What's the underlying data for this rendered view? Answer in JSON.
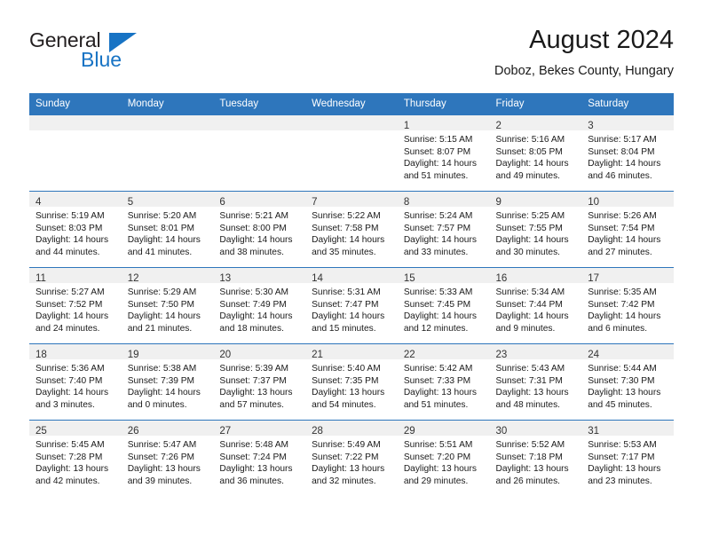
{
  "brand": {
    "name_part1": "General",
    "name_part2": "Blue",
    "accent_color": "#1773c4"
  },
  "header": {
    "title": "August 2024",
    "subtitle": "Doboz, Bekes County, Hungary"
  },
  "theme": {
    "header_bg": "#2e76bc",
    "daynum_band_bg": "#f0f0f0",
    "cell_bg": "#ffffff",
    "text_color": "#1a1a1a"
  },
  "weekdays": [
    "Sunday",
    "Monday",
    "Tuesday",
    "Wednesday",
    "Thursday",
    "Friday",
    "Saturday"
  ],
  "weeks": [
    [
      {
        "day": "",
        "sunrise": "",
        "sunset": "",
        "daylight1": "",
        "daylight2": "",
        "empty": true
      },
      {
        "day": "",
        "sunrise": "",
        "sunset": "",
        "daylight1": "",
        "daylight2": "",
        "empty": true
      },
      {
        "day": "",
        "sunrise": "",
        "sunset": "",
        "daylight1": "",
        "daylight2": "",
        "empty": true
      },
      {
        "day": "",
        "sunrise": "",
        "sunset": "",
        "daylight1": "",
        "daylight2": "",
        "empty": true
      },
      {
        "day": "1",
        "sunrise": "Sunrise: 5:15 AM",
        "sunset": "Sunset: 8:07 PM",
        "daylight1": "Daylight: 14 hours",
        "daylight2": "and 51 minutes."
      },
      {
        "day": "2",
        "sunrise": "Sunrise: 5:16 AM",
        "sunset": "Sunset: 8:05 PM",
        "daylight1": "Daylight: 14 hours",
        "daylight2": "and 49 minutes."
      },
      {
        "day": "3",
        "sunrise": "Sunrise: 5:17 AM",
        "sunset": "Sunset: 8:04 PM",
        "daylight1": "Daylight: 14 hours",
        "daylight2": "and 46 minutes."
      }
    ],
    [
      {
        "day": "4",
        "sunrise": "Sunrise: 5:19 AM",
        "sunset": "Sunset: 8:03 PM",
        "daylight1": "Daylight: 14 hours",
        "daylight2": "and 44 minutes."
      },
      {
        "day": "5",
        "sunrise": "Sunrise: 5:20 AM",
        "sunset": "Sunset: 8:01 PM",
        "daylight1": "Daylight: 14 hours",
        "daylight2": "and 41 minutes."
      },
      {
        "day": "6",
        "sunrise": "Sunrise: 5:21 AM",
        "sunset": "Sunset: 8:00 PM",
        "daylight1": "Daylight: 14 hours",
        "daylight2": "and 38 minutes."
      },
      {
        "day": "7",
        "sunrise": "Sunrise: 5:22 AM",
        "sunset": "Sunset: 7:58 PM",
        "daylight1": "Daylight: 14 hours",
        "daylight2": "and 35 minutes."
      },
      {
        "day": "8",
        "sunrise": "Sunrise: 5:24 AM",
        "sunset": "Sunset: 7:57 PM",
        "daylight1": "Daylight: 14 hours",
        "daylight2": "and 33 minutes."
      },
      {
        "day": "9",
        "sunrise": "Sunrise: 5:25 AM",
        "sunset": "Sunset: 7:55 PM",
        "daylight1": "Daylight: 14 hours",
        "daylight2": "and 30 minutes."
      },
      {
        "day": "10",
        "sunrise": "Sunrise: 5:26 AM",
        "sunset": "Sunset: 7:54 PM",
        "daylight1": "Daylight: 14 hours",
        "daylight2": "and 27 minutes."
      }
    ],
    [
      {
        "day": "11",
        "sunrise": "Sunrise: 5:27 AM",
        "sunset": "Sunset: 7:52 PM",
        "daylight1": "Daylight: 14 hours",
        "daylight2": "and 24 minutes."
      },
      {
        "day": "12",
        "sunrise": "Sunrise: 5:29 AM",
        "sunset": "Sunset: 7:50 PM",
        "daylight1": "Daylight: 14 hours",
        "daylight2": "and 21 minutes."
      },
      {
        "day": "13",
        "sunrise": "Sunrise: 5:30 AM",
        "sunset": "Sunset: 7:49 PM",
        "daylight1": "Daylight: 14 hours",
        "daylight2": "and 18 minutes."
      },
      {
        "day": "14",
        "sunrise": "Sunrise: 5:31 AM",
        "sunset": "Sunset: 7:47 PM",
        "daylight1": "Daylight: 14 hours",
        "daylight2": "and 15 minutes."
      },
      {
        "day": "15",
        "sunrise": "Sunrise: 5:33 AM",
        "sunset": "Sunset: 7:45 PM",
        "daylight1": "Daylight: 14 hours",
        "daylight2": "and 12 minutes."
      },
      {
        "day": "16",
        "sunrise": "Sunrise: 5:34 AM",
        "sunset": "Sunset: 7:44 PM",
        "daylight1": "Daylight: 14 hours",
        "daylight2": "and 9 minutes."
      },
      {
        "day": "17",
        "sunrise": "Sunrise: 5:35 AM",
        "sunset": "Sunset: 7:42 PM",
        "daylight1": "Daylight: 14 hours",
        "daylight2": "and 6 minutes."
      }
    ],
    [
      {
        "day": "18",
        "sunrise": "Sunrise: 5:36 AM",
        "sunset": "Sunset: 7:40 PM",
        "daylight1": "Daylight: 14 hours",
        "daylight2": "and 3 minutes."
      },
      {
        "day": "19",
        "sunrise": "Sunrise: 5:38 AM",
        "sunset": "Sunset: 7:39 PM",
        "daylight1": "Daylight: 14 hours",
        "daylight2": "and 0 minutes."
      },
      {
        "day": "20",
        "sunrise": "Sunrise: 5:39 AM",
        "sunset": "Sunset: 7:37 PM",
        "daylight1": "Daylight: 13 hours",
        "daylight2": "and 57 minutes."
      },
      {
        "day": "21",
        "sunrise": "Sunrise: 5:40 AM",
        "sunset": "Sunset: 7:35 PM",
        "daylight1": "Daylight: 13 hours",
        "daylight2": "and 54 minutes."
      },
      {
        "day": "22",
        "sunrise": "Sunrise: 5:42 AM",
        "sunset": "Sunset: 7:33 PM",
        "daylight1": "Daylight: 13 hours",
        "daylight2": "and 51 minutes."
      },
      {
        "day": "23",
        "sunrise": "Sunrise: 5:43 AM",
        "sunset": "Sunset: 7:31 PM",
        "daylight1": "Daylight: 13 hours",
        "daylight2": "and 48 minutes."
      },
      {
        "day": "24",
        "sunrise": "Sunrise: 5:44 AM",
        "sunset": "Sunset: 7:30 PM",
        "daylight1": "Daylight: 13 hours",
        "daylight2": "and 45 minutes."
      }
    ],
    [
      {
        "day": "25",
        "sunrise": "Sunrise: 5:45 AM",
        "sunset": "Sunset: 7:28 PM",
        "daylight1": "Daylight: 13 hours",
        "daylight2": "and 42 minutes."
      },
      {
        "day": "26",
        "sunrise": "Sunrise: 5:47 AM",
        "sunset": "Sunset: 7:26 PM",
        "daylight1": "Daylight: 13 hours",
        "daylight2": "and 39 minutes."
      },
      {
        "day": "27",
        "sunrise": "Sunrise: 5:48 AM",
        "sunset": "Sunset: 7:24 PM",
        "daylight1": "Daylight: 13 hours",
        "daylight2": "and 36 minutes."
      },
      {
        "day": "28",
        "sunrise": "Sunrise: 5:49 AM",
        "sunset": "Sunset: 7:22 PM",
        "daylight1": "Daylight: 13 hours",
        "daylight2": "and 32 minutes."
      },
      {
        "day": "29",
        "sunrise": "Sunrise: 5:51 AM",
        "sunset": "Sunset: 7:20 PM",
        "daylight1": "Daylight: 13 hours",
        "daylight2": "and 29 minutes."
      },
      {
        "day": "30",
        "sunrise": "Sunrise: 5:52 AM",
        "sunset": "Sunset: 7:18 PM",
        "daylight1": "Daylight: 13 hours",
        "daylight2": "and 26 minutes."
      },
      {
        "day": "31",
        "sunrise": "Sunrise: 5:53 AM",
        "sunset": "Sunset: 7:17 PM",
        "daylight1": "Daylight: 13 hours",
        "daylight2": "and 23 minutes."
      }
    ]
  ]
}
